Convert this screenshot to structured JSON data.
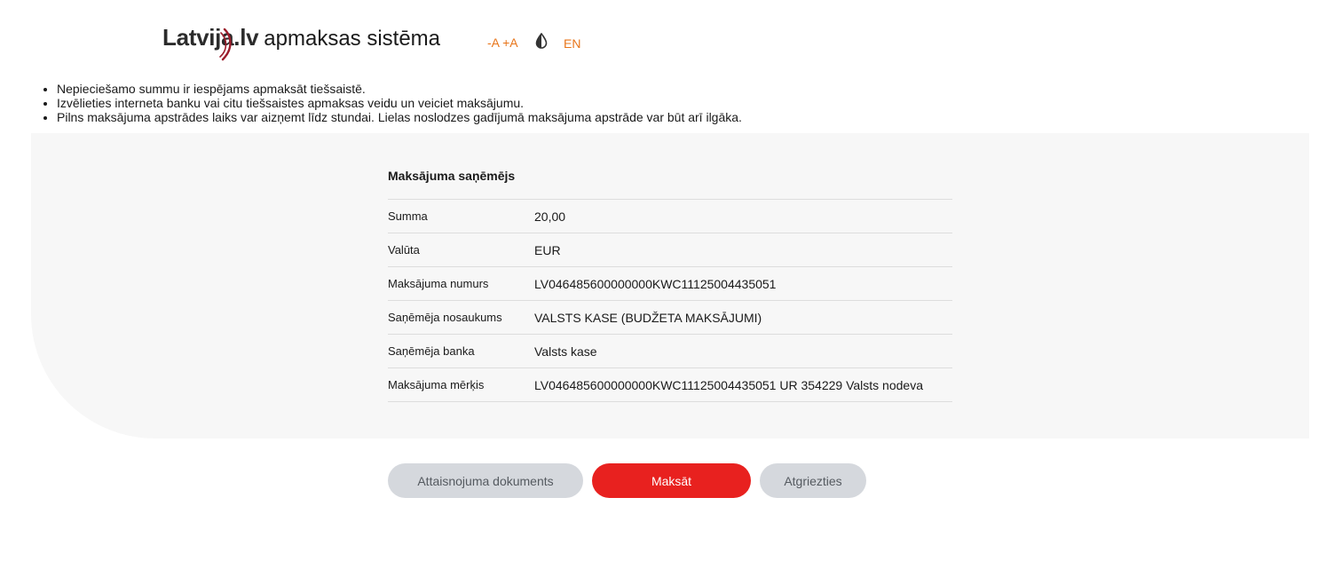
{
  "header": {
    "logo_brand": "Latvija.lv",
    "logo_suffix": "apmaksas sistēma",
    "font_decrease": "-A",
    "font_increase": "+A",
    "contrast_icon": "contrast-drop-icon",
    "language": "EN",
    "accent_color": "#e8751a"
  },
  "notes": [
    "Nepieciešamo summu ir iespējams apmaksāt tiešsaistē.",
    "Izvēlieties interneta banku vai citu tiešsaistes apmaksas veidu un veiciet maksājumu.",
    "Pilns maksājuma apstrādes laiks var aizņemt līdz stundai. Lielas noslodzes gadījumā maksājuma apstrāde var būt arī ilgāka."
  ],
  "payment": {
    "title": "Maksājuma saņēmējs",
    "rows": [
      {
        "label": "Summa",
        "value": "20,00"
      },
      {
        "label": "Valūta",
        "value": "EUR"
      },
      {
        "label": "Maksājuma numurs",
        "value": "LV046485600000000KWC11125004435051"
      },
      {
        "label": "Saņēmēja nosaukums",
        "value": "VALSTS KASE (BUDŽETA MAKSĀJUMI)"
      },
      {
        "label": "Saņēmēja banka",
        "value": "Valsts kase"
      },
      {
        "label": "Maksājuma mērķis",
        "value": "LV046485600000000KWC11125004435051 UR 354229 Valsts nodeva"
      }
    ]
  },
  "actions": {
    "document_label": "Attaisnojuma dokuments",
    "pay_label": "Maksāt",
    "back_label": "Atgriezties",
    "primary_color": "#e8211f",
    "secondary_color": "#d5d8dd"
  }
}
